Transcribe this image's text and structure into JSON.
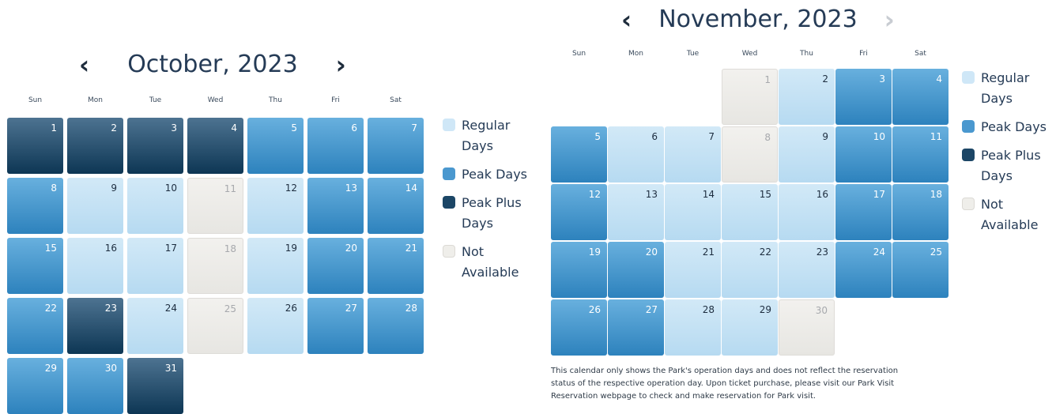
{
  "weekdays": [
    "Sun",
    "Mon",
    "Tue",
    "Wed",
    "Thu",
    "Fri",
    "Sat"
  ],
  "october": {
    "title": "October, 2023",
    "prev_icon": "chevron-left-icon",
    "next_icon": "chevron-right-icon",
    "days": [
      {
        "n": "1",
        "s": "peakplus"
      },
      {
        "n": "2",
        "s": "peakplus"
      },
      {
        "n": "3",
        "s": "peakplus"
      },
      {
        "n": "4",
        "s": "peakplus"
      },
      {
        "n": "5",
        "s": "peak"
      },
      {
        "n": "6",
        "s": "peak"
      },
      {
        "n": "7",
        "s": "peak"
      },
      {
        "n": "8",
        "s": "peak"
      },
      {
        "n": "9",
        "s": "regular"
      },
      {
        "n": "10",
        "s": "regular"
      },
      {
        "n": "11",
        "s": "na"
      },
      {
        "n": "12",
        "s": "regular"
      },
      {
        "n": "13",
        "s": "peak"
      },
      {
        "n": "14",
        "s": "peak"
      },
      {
        "n": "15",
        "s": "peak"
      },
      {
        "n": "16",
        "s": "regular"
      },
      {
        "n": "17",
        "s": "regular"
      },
      {
        "n": "18",
        "s": "na"
      },
      {
        "n": "19",
        "s": "regular"
      },
      {
        "n": "20",
        "s": "peak"
      },
      {
        "n": "21",
        "s": "peak"
      },
      {
        "n": "22",
        "s": "peak"
      },
      {
        "n": "23",
        "s": "peakplus"
      },
      {
        "n": "24",
        "s": "regular"
      },
      {
        "n": "25",
        "s": "na"
      },
      {
        "n": "26",
        "s": "regular"
      },
      {
        "n": "27",
        "s": "peak"
      },
      {
        "n": "28",
        "s": "peak"
      },
      {
        "n": "29",
        "s": "peak"
      },
      {
        "n": "30",
        "s": "peak"
      },
      {
        "n": "31",
        "s": "peakplus"
      }
    ]
  },
  "november": {
    "title": "November, 2023",
    "prev_icon": "chevron-left-icon",
    "next_icon": "chevron-right-icon",
    "days": [
      {
        "n": "1",
        "s": "na"
      },
      {
        "n": "2",
        "s": "regular"
      },
      {
        "n": "3",
        "s": "peak"
      },
      {
        "n": "4",
        "s": "peak"
      },
      {
        "n": "5",
        "s": "peak"
      },
      {
        "n": "6",
        "s": "regular"
      },
      {
        "n": "7",
        "s": "regular"
      },
      {
        "n": "8",
        "s": "na"
      },
      {
        "n": "9",
        "s": "regular"
      },
      {
        "n": "10",
        "s": "peak"
      },
      {
        "n": "11",
        "s": "peak"
      },
      {
        "n": "12",
        "s": "peak"
      },
      {
        "n": "13",
        "s": "regular"
      },
      {
        "n": "14",
        "s": "regular"
      },
      {
        "n": "15",
        "s": "regular"
      },
      {
        "n": "16",
        "s": "regular"
      },
      {
        "n": "17",
        "s": "peak"
      },
      {
        "n": "18",
        "s": "peak"
      },
      {
        "n": "19",
        "s": "peak"
      },
      {
        "n": "20",
        "s": "peak"
      },
      {
        "n": "21",
        "s": "regular"
      },
      {
        "n": "22",
        "s": "regular"
      },
      {
        "n": "23",
        "s": "regular"
      },
      {
        "n": "24",
        "s": "peak"
      },
      {
        "n": "25",
        "s": "peak"
      },
      {
        "n": "26",
        "s": "peak"
      },
      {
        "n": "27",
        "s": "peak"
      },
      {
        "n": "28",
        "s": "regular"
      },
      {
        "n": "29",
        "s": "regular"
      },
      {
        "n": "30",
        "s": "na"
      }
    ]
  },
  "legend": {
    "regular_line1": "Regular",
    "regular_line2": "Days",
    "peak_line1": "Peak Days",
    "peakplus_line1": "Peak Plus",
    "peakplus_line2": "Days",
    "na_line1": "Not",
    "na_line2": "Available"
  },
  "colors": {
    "regular": "#c6e2f5",
    "peak": "#3f8fc9",
    "peakplus": "#1c4666",
    "not_available": "#eeede9",
    "title_text": "#253b56"
  },
  "note": {
    "line1": "This calendar only shows the Park's operation days and does not reflect the reservation",
    "line2": "status of the respective operation day. Upon ticket purchase, please visit our Park Visit",
    "line3": "Reservation webpage to check and make reservation for Park visit."
  }
}
